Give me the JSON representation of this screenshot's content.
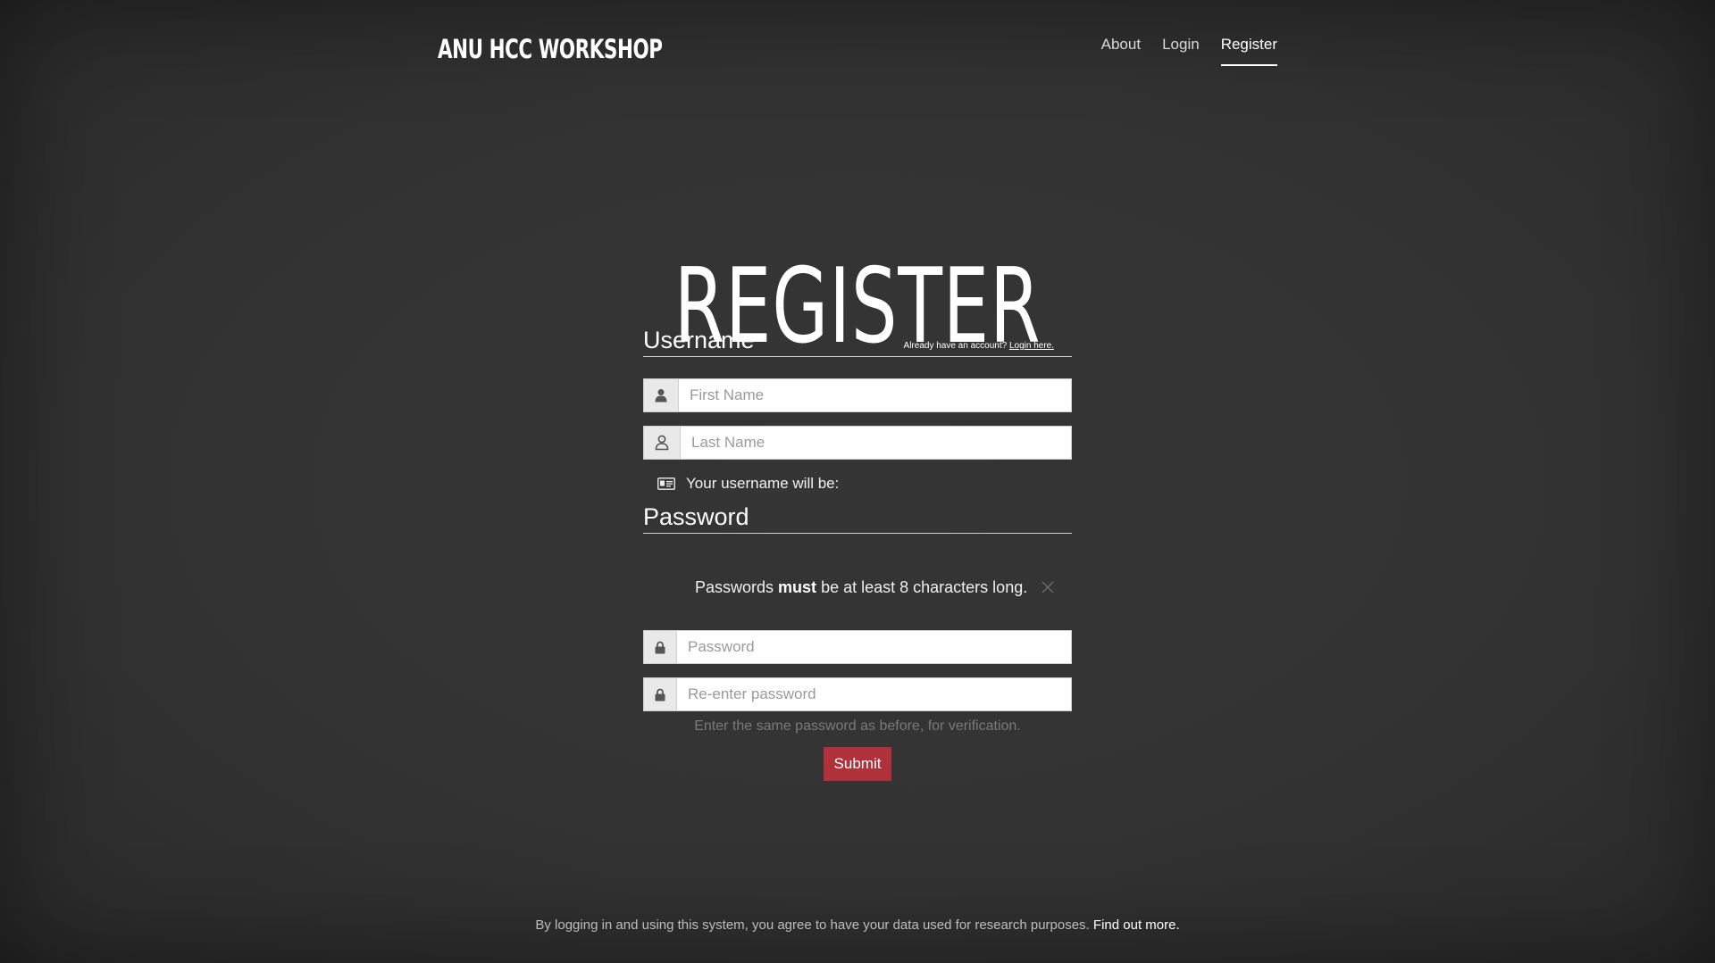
{
  "header": {
    "logo": "ANU HCC WORKSHOP",
    "nav": [
      {
        "label": "About"
      },
      {
        "label": "Login"
      },
      {
        "label": "Register"
      }
    ]
  },
  "page": {
    "title": "REGISTER"
  },
  "username_section": {
    "title": "Username",
    "login_hint_text": "Already have an account?",
    "login_hint_link": "Login here.",
    "first_name_placeholder": "First Name",
    "last_name_placeholder": "Last Name",
    "username_preview_label": "Your username will be:"
  },
  "password_section": {
    "title": "Password",
    "alert_prefix": "Passwords",
    "alert_emphasis": "must",
    "alert_suffix": "be at least 8 characters long.",
    "password_placeholder": "Password",
    "reenter_placeholder": "Re-enter password",
    "help_text": "Enter the same password as before, for verification."
  },
  "submit_label": "Submit",
  "footer": {
    "text": "By logging in and using this system, you agree to have your data used for research purposes.",
    "link": "Find out more."
  },
  "icons": {
    "first_name": "user-icon",
    "last_name": "user-outline-icon",
    "username_preview": "id-card-icon",
    "password": "lock-icon",
    "reenter_password": "lock-icon",
    "alert_close": "close-icon"
  },
  "colors": {
    "background": "#333333",
    "submit": "#b0313a",
    "text": "#ffffff"
  }
}
